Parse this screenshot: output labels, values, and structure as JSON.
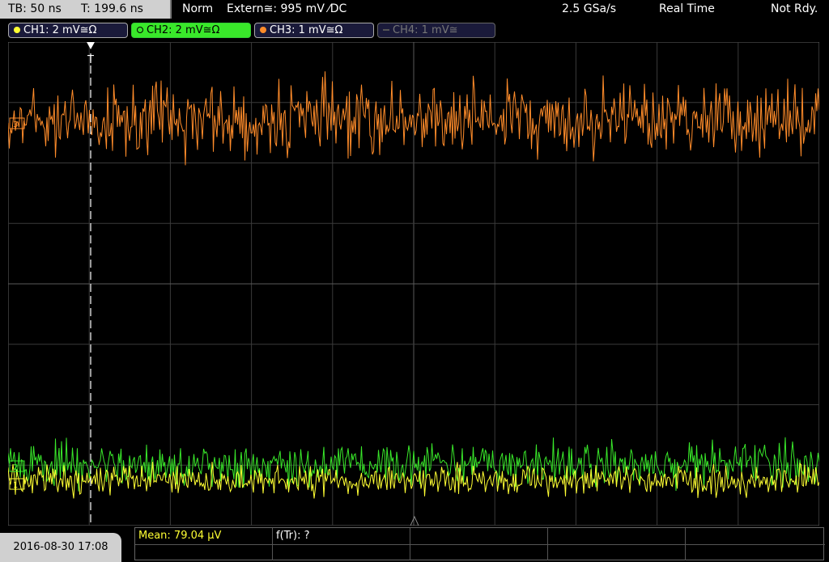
{
  "header": {
    "tb": "TB: 50 ns",
    "t": "T: 199.6 ns",
    "mode": "Norm",
    "trigger": "Extern≅: 995 mV ⁄DC",
    "sample_rate": "2.5 GSa/s",
    "acq": "Real Time",
    "status": "Not Rdy."
  },
  "channels": [
    {
      "label": "CH1: 2 mV≅Ω",
      "color": "#ffff33"
    },
    {
      "label": "CH2: 2 mV≅Ω",
      "color": "#39e82a"
    },
    {
      "label": "CH3: 1 mV≅Ω",
      "color": "#ff8c2a"
    },
    {
      "label": "CH4: 1 mV≅",
      "color": "#777777"
    }
  ],
  "screen": {
    "trigger_marker": "T",
    "ch3_marker": "3",
    "ch2_marker": "2",
    "ch1_marker": "1"
  },
  "footer": {
    "datetime": "2016-08-30 17:08",
    "mean": "Mean: 79.04 µV",
    "freq": "f(Tr): ?"
  }
}
